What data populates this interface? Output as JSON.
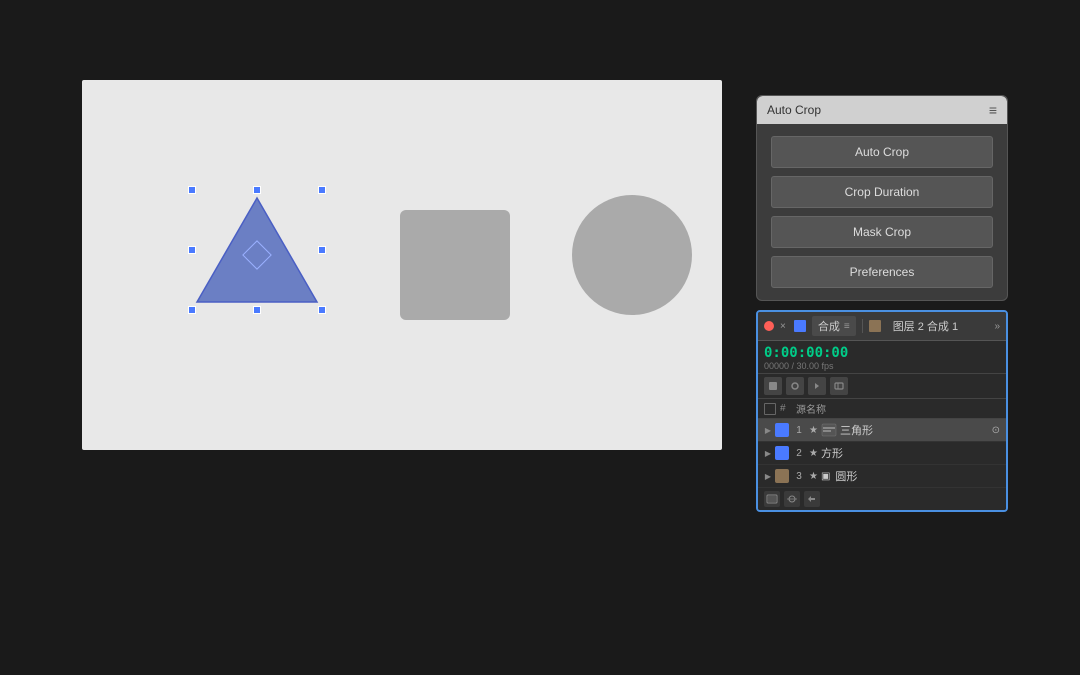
{
  "background": "#1a1a1a",
  "canvas": {
    "background": "#e8e8e8"
  },
  "autocrop_panel": {
    "title": "Auto Crop",
    "menu_icon": "≡",
    "buttons": [
      {
        "label": "Auto Crop",
        "key": "auto-crop"
      },
      {
        "label": "Crop Duration",
        "key": "crop-duration"
      },
      {
        "label": "Mask Crop",
        "key": "mask-crop"
      },
      {
        "label": "Preferences",
        "key": "preferences"
      }
    ]
  },
  "timeline": {
    "title": "合成",
    "tab2": "图层 2 合成 1",
    "timecode": "0:00:00:00",
    "time_detail": "00000 / 30.00 fps",
    "col_header": "源名称",
    "layers": [
      {
        "num": "1",
        "color": "#4a7aff",
        "name": "三角形",
        "selected": true,
        "icon_type": "shape"
      },
      {
        "num": "2",
        "color": "#4a7aff",
        "name": "方形",
        "selected": false,
        "icon_type": "shape"
      },
      {
        "num": "3",
        "color": "#8B7355",
        "name": "圆形",
        "selected": false,
        "icon_type": "shape"
      }
    ]
  },
  "icons": {
    "menu": "≡",
    "expand": "▶",
    "star": "★",
    "arrow": "»",
    "close": "×"
  }
}
